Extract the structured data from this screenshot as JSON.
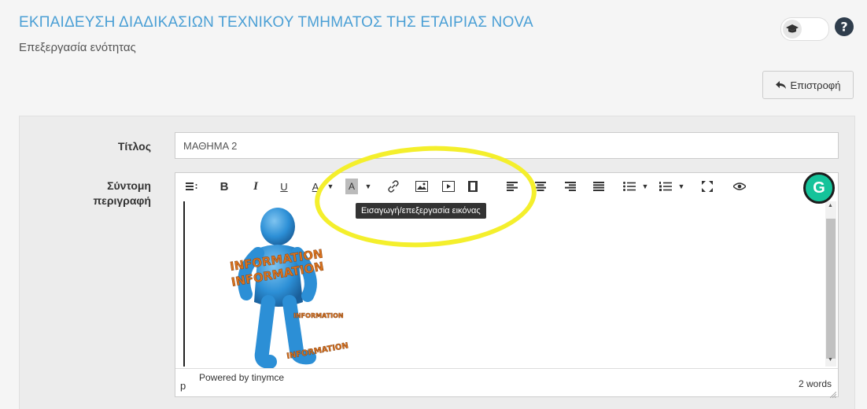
{
  "page": {
    "title": "ΕΚΠΑΙΔΕΥΣΗ ΔΙΑΔΙΚΑΣΙΩΝ ΤΕΧΝΙΚΟΥ ΤΜΗΜΑΤΟΣ ΤΗΣ ΕΤΑΙΡΙΑΣ NOVA",
    "subtitle": "Επεξεργασία ενότητας",
    "accent_color": "#4a9fd5"
  },
  "header": {
    "toggle_icon": "graduation-cap-icon",
    "help_icon": "question-circle-icon"
  },
  "back_button": {
    "label": "Επιστροφή",
    "icon": "reply-arrow-icon"
  },
  "form": {
    "title_label": "Τίτλος",
    "title_value": "ΜΑΘΗΜΑ 2",
    "description_label_line1": "Σύντομη",
    "description_label_line2": "περιγραφή"
  },
  "editor": {
    "toolbar_buttons": [
      "formats-icon",
      "bold-icon",
      "italic-icon",
      "underline-icon",
      "text-color-icon",
      "background-color-icon",
      "link-icon",
      "image-icon",
      "media-icon",
      "video-icon",
      "align-left-icon",
      "align-center-icon",
      "align-right-icon",
      "justify-icon",
      "bullet-list-icon",
      "numbered-list-icon",
      "fullscreen-icon",
      "preview-icon"
    ],
    "bold_glyph": "B",
    "italic_glyph": "I",
    "underline_glyph": "U",
    "text_color_glyph": "A",
    "bg_color_glyph": "A",
    "tooltip": "Εισαγωγή/επεξεργασία εικόνας",
    "path": "p",
    "powered_by": "Powered by tinymce",
    "word_count": "2 words",
    "image_words": [
      "INFORMATION",
      "INFORMATION",
      "INFORMATION",
      "INFORMATION"
    ]
  },
  "grammarly": {
    "letter": "G",
    "color": "#15c39a"
  },
  "annotation": {
    "highlight_color": "#f4ef2c"
  }
}
